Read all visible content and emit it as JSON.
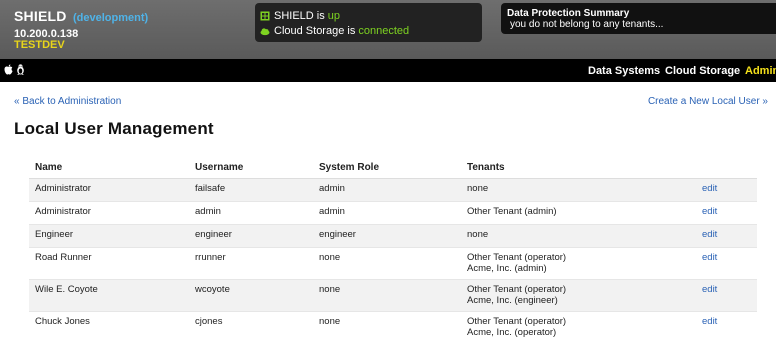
{
  "header": {
    "app_name": "SHIELD",
    "environment": "(development)",
    "ip": "10.200.0.138",
    "env_label": "TESTDEV"
  },
  "status": {
    "shield_prefix": "SHIELD is ",
    "shield_state": "up",
    "storage_prefix": "Cloud Storage is ",
    "storage_state": "connected",
    "ok_color": "#7ed321"
  },
  "data_protection": {
    "title": "Data Protection Summary",
    "message": "you do not belong to any tenants..."
  },
  "nav": {
    "icons": [
      "apple-icon",
      "linux-icon"
    ],
    "items": [
      {
        "label": "Data Systems"
      },
      {
        "label": "Cloud Storage"
      },
      {
        "label": "Admin",
        "active": true
      }
    ],
    "active_color": "#f5e11a"
  },
  "page": {
    "back_link": "« Back to Administration",
    "create_link": "Create a New Local User »",
    "title": "Local User Management"
  },
  "table": {
    "headers": [
      "Name",
      "Username",
      "System Role",
      "Tenants"
    ],
    "rows": [
      {
        "name": "Administrator",
        "username": "failsafe",
        "role": "admin",
        "tenants": "none",
        "action": "edit"
      },
      {
        "name": "Administrator",
        "username": "admin",
        "role": "admin",
        "tenants": "Other Tenant (admin)",
        "action": "edit"
      },
      {
        "name": "Engineer",
        "username": "engineer",
        "role": "engineer",
        "tenants": "none",
        "action": "edit"
      },
      {
        "name": "Road Runner",
        "username": "rrunner",
        "role": "none",
        "tenants": "Other Tenant (operator)\nAcme, Inc. (admin)",
        "action": "edit"
      },
      {
        "name": "Wile E. Coyote",
        "username": "wcoyote",
        "role": "none",
        "tenants": "Other Tenant (operator)\nAcme, Inc. (engineer)",
        "action": "edit"
      },
      {
        "name": "Chuck Jones",
        "username": "cjones",
        "role": "none",
        "tenants": "Other Tenant (operator)\nAcme, Inc. (operator)",
        "action": "edit"
      }
    ]
  }
}
